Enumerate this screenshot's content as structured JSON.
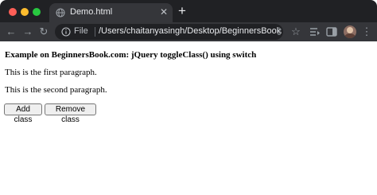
{
  "browser": {
    "tab": {
      "title": "Demo.html",
      "close": "✕"
    },
    "new_tab": "+",
    "toolbar": {
      "back": "←",
      "forward": "→",
      "reload": "↻",
      "scheme": "File",
      "url": "/Users/chaitanyasingh/Desktop/BeginnersBook/...",
      "share": "⇪",
      "bookmark": "☆",
      "menu": "⋮"
    }
  },
  "page": {
    "heading": "Example on BeginnersBook.com: jQuery toggleClass() using switch",
    "paragraphs": [
      "This is the first paragraph.",
      "This is the second paragraph."
    ],
    "buttons": {
      "add": "Add class",
      "remove": "Remove class"
    }
  },
  "colors": {
    "tabstrip": "#202124",
    "toolbar": "#35363a",
    "traffic_red": "#ff5f57",
    "traffic_yellow": "#febc2e",
    "traffic_green": "#28c840"
  }
}
